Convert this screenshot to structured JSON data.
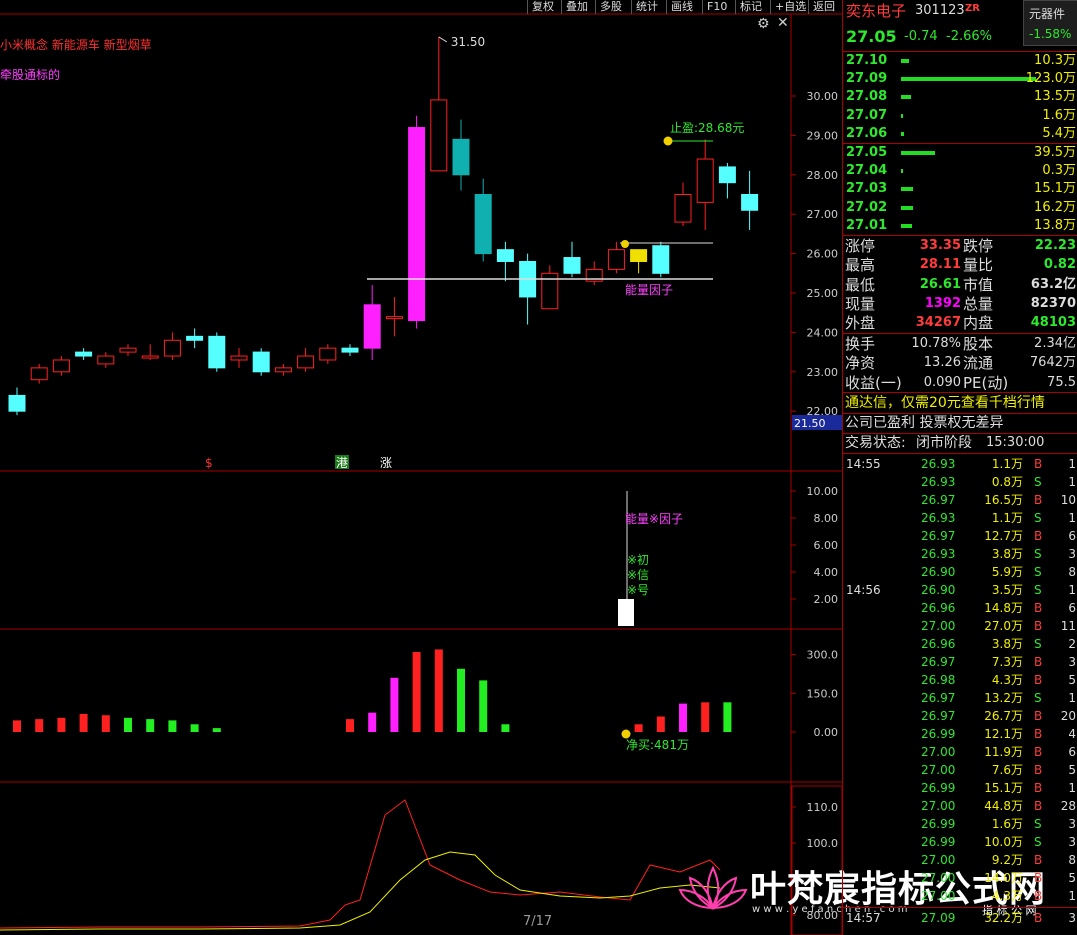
{
  "toolbar": {
    "buttons": [
      "复权",
      "叠加",
      "多股",
      "统计",
      "画线",
      "F10",
      "标记",
      "+自选",
      "返回"
    ]
  },
  "main_chart": {
    "concept_tags": "小米概念 新能源车 新型烟草",
    "indicator_name": "牵股通标的",
    "high_label": "31.50",
    "take_profit_label": "止盈:28.68元",
    "energy_label": "能量因子",
    "price_ticks": [
      "30.00",
      "29.00",
      "28.00",
      "27.00",
      "26.00",
      "25.00",
      "24.00",
      "23.00",
      "22.00"
    ],
    "current_price_tag": "21.50",
    "markers": [
      "$",
      "港",
      "涨"
    ],
    "candles": [
      {
        "o": 22.4,
        "c": 22.0,
        "h": 22.6,
        "l": 21.9
      },
      {
        "o": 22.8,
        "c": 23.1,
        "h": 23.2,
        "l": 22.7
      },
      {
        "o": 23.0,
        "c": 23.3,
        "h": 23.4,
        "l": 22.9
      },
      {
        "o": 23.5,
        "c": 23.4,
        "h": 23.6,
        "l": 23.3
      },
      {
        "o": 23.2,
        "c": 23.4,
        "h": 23.5,
        "l": 23.1
      },
      {
        "o": 23.5,
        "c": 23.6,
        "h": 23.7,
        "l": 23.4
      },
      {
        "o": 23.4,
        "c": 23.4,
        "h": 23.7,
        "l": 23.3
      },
      {
        "o": 23.4,
        "c": 23.8,
        "h": 24.0,
        "l": 23.3
      },
      {
        "o": 23.9,
        "c": 23.8,
        "h": 24.1,
        "l": 23.6
      },
      {
        "o": 23.9,
        "c": 23.1,
        "h": 24.0,
        "l": 23.0
      },
      {
        "o": 23.3,
        "c": 23.4,
        "h": 23.6,
        "l": 23.1
      },
      {
        "o": 23.5,
        "c": 23.0,
        "h": 23.6,
        "l": 22.9
      },
      {
        "o": 23.0,
        "c": 23.1,
        "h": 23.2,
        "l": 22.9
      },
      {
        "o": 23.1,
        "c": 23.4,
        "h": 23.6,
        "l": 23.0
      },
      {
        "o": 23.3,
        "c": 23.6,
        "h": 23.7,
        "l": 23.2
      },
      {
        "o": 23.6,
        "c": 23.5,
        "h": 23.7,
        "l": 23.4
      },
      {
        "o": 23.6,
        "c": 24.7,
        "h": 25.2,
        "l": 23.3
      },
      {
        "o": 24.4,
        "c": 24.4,
        "h": 24.9,
        "l": 23.9
      },
      {
        "o": 24.3,
        "c": 29.2,
        "h": 29.5,
        "l": 24.1
      },
      {
        "o": 28.1,
        "c": 29.9,
        "h": 31.5,
        "l": 28.1
      },
      {
        "o": 28.9,
        "c": 28.0,
        "h": 29.4,
        "l": 27.6
      },
      {
        "o": 27.5,
        "c": 26.0,
        "h": 27.9,
        "l": 25.8
      },
      {
        "o": 26.1,
        "c": 25.8,
        "h": 26.3,
        "l": 25.3
      },
      {
        "o": 25.8,
        "c": 24.9,
        "h": 26.0,
        "l": 24.2
      },
      {
        "o": 24.6,
        "c": 25.5,
        "h": 25.7,
        "l": 24.6
      },
      {
        "o": 25.9,
        "c": 25.5,
        "h": 26.3,
        "l": 25.4
      },
      {
        "o": 25.3,
        "c": 25.6,
        "h": 25.8,
        "l": 25.2
      },
      {
        "o": 25.6,
        "c": 26.1,
        "h": 26.3,
        "l": 25.5
      },
      {
        "o": 26.1,
        "c": 25.8,
        "h": 26.1,
        "l": 25.5
      },
      {
        "o": 26.2,
        "c": 25.5,
        "h": 26.3,
        "l": 25.4
      },
      {
        "o": 26.8,
        "c": 27.5,
        "h": 27.8,
        "l": 26.7
      },
      {
        "o": 27.3,
        "c": 28.4,
        "h": 28.9,
        "l": 26.6
      },
      {
        "o": 28.2,
        "c": 27.8,
        "h": 28.3,
        "l": 27.4
      },
      {
        "o": 27.5,
        "c": 27.1,
        "h": 28.1,
        "l": 26.6
      }
    ]
  },
  "energy_panel": {
    "ticks": [
      "10.00",
      "8.00",
      "6.00",
      "4.00",
      "2.00"
    ],
    "label": "能量※因子",
    "signal_lines": [
      "※初",
      "※信",
      "※号"
    ]
  },
  "flow_panel": {
    "ticks": [
      "300.0",
      "150.0",
      "0.00"
    ],
    "net_buy_label": "净买:481万",
    "bars": [
      {
        "v": 45,
        "c": "#ff2020"
      },
      {
        "v": 50,
        "c": "#ff2020"
      },
      {
        "v": 55,
        "c": "#ff2020"
      },
      {
        "v": 70,
        "c": "#ff2020"
      },
      {
        "v": 65,
        "c": "#ff2020"
      },
      {
        "v": 55,
        "c": "#22ee22"
      },
      {
        "v": 50,
        "c": "#22ee22"
      },
      {
        "v": 45,
        "c": "#22ee22"
      },
      {
        "v": 30,
        "c": "#22ee22"
      },
      {
        "v": 15,
        "c": "#22ee22"
      },
      {
        "v": 0,
        "c": "#000"
      },
      {
        "v": 0,
        "c": "#000"
      },
      {
        "v": 0,
        "c": "#000"
      },
      {
        "v": 0,
        "c": "#000"
      },
      {
        "v": 0,
        "c": "#000"
      },
      {
        "v": 50,
        "c": "#ff2020"
      },
      {
        "v": 75,
        "c": "#ff20ff"
      },
      {
        "v": 210,
        "c": "#ff20ff"
      },
      {
        "v": 310,
        "c": "#ff2020"
      },
      {
        "v": 320,
        "c": "#ff2020"
      },
      {
        "v": 245,
        "c": "#22ee22"
      },
      {
        "v": 200,
        "c": "#22ee22"
      },
      {
        "v": 30,
        "c": "#22ee22"
      },
      {
        "v": 0,
        "c": "#000"
      },
      {
        "v": 0,
        "c": "#000"
      },
      {
        "v": 0,
        "c": "#000"
      },
      {
        "v": 0,
        "c": "#000"
      },
      {
        "v": 0,
        "c": "#000"
      },
      {
        "v": 30,
        "c": "#ff2020"
      },
      {
        "v": 60,
        "c": "#ff2020"
      },
      {
        "v": 110,
        "c": "#ff20ff"
      },
      {
        "v": 115,
        "c": "#ff2020"
      },
      {
        "v": 115,
        "c": "#22ee22"
      }
    ]
  },
  "osc_panel": {
    "ticks": [
      "110.0",
      "100.0",
      "80.00"
    ]
  },
  "page_indicator": "7/17",
  "watermark": {
    "text": "叶梵宸指标公式网",
    "url": "w w w . y e f a n c h e n . c o m",
    "sub": "指 标 公 网"
  },
  "quote": {
    "name": "奕东电子",
    "code": "301123",
    "badge": "ZR",
    "sector": "元器件",
    "sector_pct": "-1.58%",
    "price": "27.05",
    "change": "-0.74",
    "change_pct": "-2.66%",
    "asks": [
      {
        "p": "27.10",
        "v": "10.3万",
        "w": 8
      },
      {
        "p": "27.09",
        "v": "123.0万",
        "w": 135
      },
      {
        "p": "27.08",
        "v": "13.5万",
        "w": 10
      },
      {
        "p": "27.07",
        "v": "1.6万",
        "w": 2
      },
      {
        "p": "27.06",
        "v": "5.4万",
        "w": 3
      }
    ],
    "bids": [
      {
        "p": "27.05",
        "v": "39.5万",
        "w": 34
      },
      {
        "p": "27.04",
        "v": "0.3万",
        "w": 2
      },
      {
        "p": "27.03",
        "v": "15.1万",
        "w": 12
      },
      {
        "p": "27.02",
        "v": "16.2万",
        "w": 12
      },
      {
        "p": "27.01",
        "v": "13.8万",
        "w": 11
      }
    ],
    "stats": [
      {
        "l1": "涨停",
        "v1": "33.35",
        "c1": "red",
        "l2": "跌停",
        "v2": "22.23",
        "c2": "green"
      },
      {
        "l1": "最高",
        "v1": "28.11",
        "c1": "red",
        "l2": "量比",
        "v2": "0.82",
        "c2": "green"
      },
      {
        "l1": "最低",
        "v1": "26.61",
        "c1": "green",
        "l2": "市值",
        "v2": "63.2亿",
        "c2": "white"
      },
      {
        "l1": "现量",
        "v1": "1392",
        "c1": "mag",
        "l2": "总量",
        "v2": "82370",
        "c2": "white"
      },
      {
        "l1": "外盘",
        "v1": "34267",
        "c1": "red",
        "l2": "内盘",
        "v2": "48103",
        "c2": "green"
      }
    ],
    "stats2": [
      {
        "l1": "换手",
        "v1": "10.78%",
        "l2": "股本",
        "v2": "2.34亿"
      },
      {
        "l1": "净资",
        "v1": "13.26",
        "l2": "流通",
        "v2": "7642万"
      },
      {
        "l1": "收益(一)",
        "v1": "0.090",
        "l2": "PE(动)",
        "v2": "75.5"
      }
    ],
    "promo": "通达信，仅需20元查看千档行情",
    "notice": "公司已盈利 投票权无差异",
    "status_label": "交易状态:",
    "status_value": "闭市阶段",
    "status_time": "15:30:00",
    "ticks_1455_time": "14:55",
    "ticks_1455": [
      {
        "p": "26.93",
        "v": "1.1万",
        "s": "B",
        "n": "1"
      },
      {
        "p": "26.93",
        "v": "0.8万",
        "s": "S",
        "n": "1"
      },
      {
        "p": "26.97",
        "v": "16.5万",
        "s": "B",
        "n": "10"
      },
      {
        "p": "26.93",
        "v": "1.1万",
        "s": "S",
        "n": "1"
      },
      {
        "p": "26.97",
        "v": "12.7万",
        "s": "B",
        "n": "6"
      },
      {
        "p": "26.93",
        "v": "3.8万",
        "s": "S",
        "n": "3"
      },
      {
        "p": "26.90",
        "v": "5.9万",
        "s": "S",
        "n": "8"
      }
    ],
    "ticks_1456_time": "14:56",
    "ticks_1456": [
      {
        "p": "26.90",
        "v": "3.5万",
        "s": "S",
        "n": "1"
      },
      {
        "p": "26.96",
        "v": "14.8万",
        "s": "B",
        "n": "6"
      },
      {
        "p": "27.00",
        "v": "27.0万",
        "s": "B",
        "n": "11"
      },
      {
        "p": "26.96",
        "v": "3.8万",
        "s": "S",
        "n": "2"
      },
      {
        "p": "26.97",
        "v": "7.3万",
        "s": "B",
        "n": "3"
      },
      {
        "p": "26.98",
        "v": "4.3万",
        "s": "B",
        "n": "5"
      },
      {
        "p": "26.97",
        "v": "13.2万",
        "s": "S",
        "n": "1"
      },
      {
        "p": "26.97",
        "v": "26.7万",
        "s": "B",
        "n": "20"
      },
      {
        "p": "26.99",
        "v": "12.1万",
        "s": "B",
        "n": "4"
      },
      {
        "p": "27.00",
        "v": "11.9万",
        "s": "B",
        "n": "6"
      },
      {
        "p": "27.00",
        "v": "7.6万",
        "s": "B",
        "n": "5"
      },
      {
        "p": "26.99",
        "v": "15.1万",
        "s": "B",
        "n": "1"
      },
      {
        "p": "27.00",
        "v": "44.8万",
        "s": "B",
        "n": "28"
      },
      {
        "p": "26.99",
        "v": "1.6万",
        "s": "S",
        "n": "3"
      },
      {
        "p": "26.99",
        "v": "10.0万",
        "s": "S",
        "n": "3"
      },
      {
        "p": "27.00",
        "v": "9.2万",
        "s": "B",
        "n": "8"
      },
      {
        "p": "27.00",
        "v": "14.0万",
        "s": "B",
        "n": "5"
      },
      {
        "p": "27.00",
        "v": "4.3万",
        "s": "B",
        "n": "1"
      }
    ],
    "ticks_1457_time": "14:57",
    "ticks_1457": [
      {
        "p": "27.09",
        "v": "32.2万",
        "s": "B",
        "n": "3"
      }
    ]
  }
}
